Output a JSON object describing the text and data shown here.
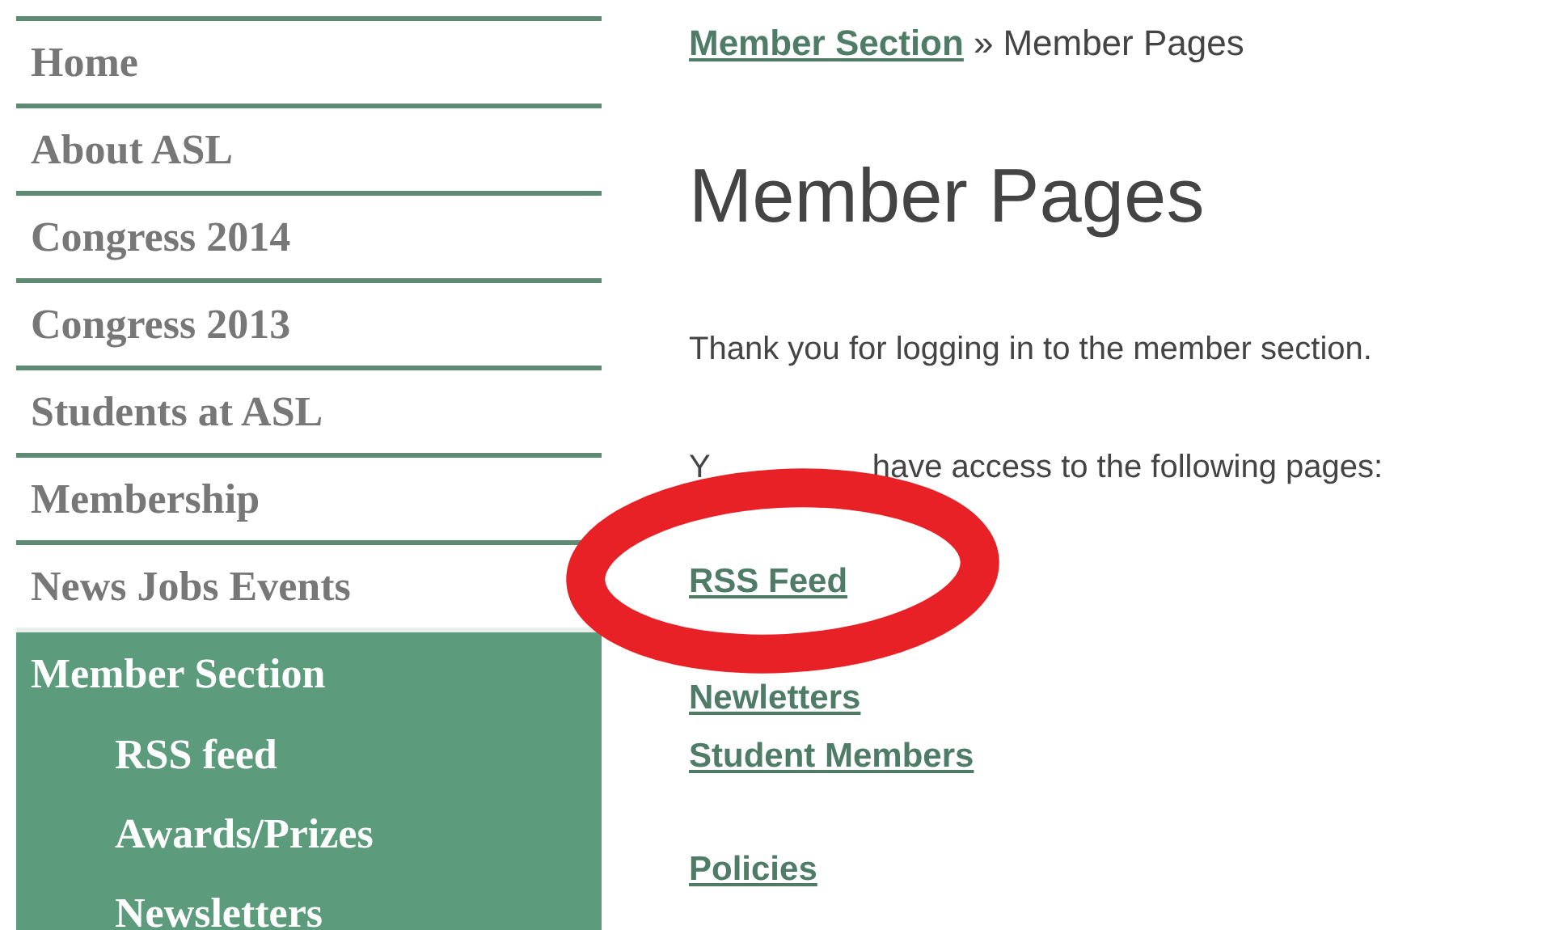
{
  "sidebar": {
    "items": [
      {
        "label": "Home",
        "selected": false
      },
      {
        "label": "About ASL",
        "selected": false
      },
      {
        "label": "Congress 2014",
        "selected": false
      },
      {
        "label": "Congress 2013",
        "selected": false
      },
      {
        "label": "Students at ASL",
        "selected": false
      },
      {
        "label": "Membership",
        "selected": false
      },
      {
        "label": "News Jobs Events",
        "selected": false
      },
      {
        "label": "Member Section",
        "selected": true,
        "children": [
          {
            "label": "RSS feed"
          },
          {
            "label": "Awards/Prizes"
          },
          {
            "label": "Newsletters"
          }
        ]
      }
    ]
  },
  "breadcrumb": {
    "link": "Member Section",
    "separator": "»",
    "current": "Member Pages"
  },
  "title": "Member Pages",
  "intro": "Thank you for logging in to the member section.",
  "access_note": {
    "start": "Y",
    "end": "have access to the following pages:"
  },
  "circled_link": {
    "label": "RSS Feed"
  },
  "page_links": [
    {
      "label": "Newletters"
    },
    {
      "label": "Student Members"
    }
  ],
  "other_links": [
    {
      "label": "Policies"
    }
  ],
  "annotation": {
    "kind": "ellipse",
    "color": "#e82127"
  }
}
